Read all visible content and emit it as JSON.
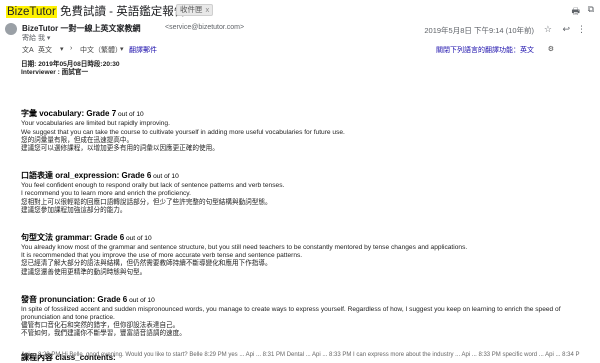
{
  "header": {
    "subject_brand": "BizeTutor",
    "subject_rest": " 免費試讀 - 英語鑑定報告",
    "inbox_label": "收件匣",
    "inbox_close": "x",
    "print_icon": "printer-icon",
    "external_icon": "open-in-new-icon"
  },
  "sender": {
    "name": "BizeTutor 一對一線上英文家教網",
    "email": "<service@bizetutor.com>",
    "to": "寄給 我 ▾",
    "date": "2019年5月8日 下午9:14 (10年前)",
    "star": "☆",
    "reply": "↩",
    "more": "⋮"
  },
  "translate": {
    "from": "英文",
    "arrow": "›",
    "to": "中文（繁體）",
    "action": "翻譯郵件",
    "right": "關閉下列語言的翻譯功能：英文"
  },
  "body": {
    "date_line": "日期: 2019年05月08日時段:20:30",
    "interviewer": "Interviewer : 面試官一",
    "sections": [
      {
        "heading": "字彙 vocabulary: Grade 7",
        "heading_suffix": " out of 10",
        "lines": [
          "Your vocabularies are limited but rapidly improving.",
          "We suggest that you can take the course to cultivate yourself in adding more useful vocabularies for future use.",
          "您的詞彙量有限，但成在迅速提高中。",
          "建議您可以選修課程，以增加更多有用的詞彙以因應更正確的使用。"
        ]
      },
      {
        "heading": "口語表達 oral_expression: Grade 6",
        "heading_suffix": " out of 10",
        "lines": [
          "You feel confident enough to respond orally but lack of sentence patterns and verb tenses.",
          "I recommend you to learn more and enrich the proficiency.",
          "您相對上可以很輕鬆的回應口語轉說話部分，但少了些許完整的句型結構與動詞型態。",
          "建議您參加課程加強這部分的能力。"
        ]
      },
      {
        "heading": "句型文法 grammar: Grade 6",
        "heading_suffix": " out of 10",
        "lines": [
          "You already know most of the grammar and sentence structure, but you still need teachers to be constantly mentored by tense changes and applications.",
          "It is recommended that you improve the use of more accurate verb tense and sentence patterns.",
          "您已經清了解大部分的語法與結構，但仍然需要教師持續不斷導變化和應用下作指導。",
          "建議您還善使用更精準的動詞時態與句型。"
        ]
      },
      {
        "heading": "發音 pronunciation: Grade 6",
        "heading_suffix": " out of 10",
        "lines": [
          "In spite of fossilized accent and sudden mispronounced words, you manage to create ways to express yourself. Regardless of how, I suggest you keep on learning to enrich the speed of pronunciation and tone practice.",
          "儘管有口音化石和突然的錯字，但你卻設法表達自己。",
          "不管如何，我們建議你不斷學習，豐富語音語調的速度。"
        ]
      }
    ],
    "class_contents_heading": "課程內容 class_contents:",
    "chat_preview": "Api ... 8:29 PM Hi Belle, good evening. Would you like to start? Belle  8:29 PM yes ... Api ... 8:31 PM Dental ... Api ... 8:33 PM I can express more about the industry ... Api ... 8:33 PM specific word ... Api ... 8:34 P"
  }
}
